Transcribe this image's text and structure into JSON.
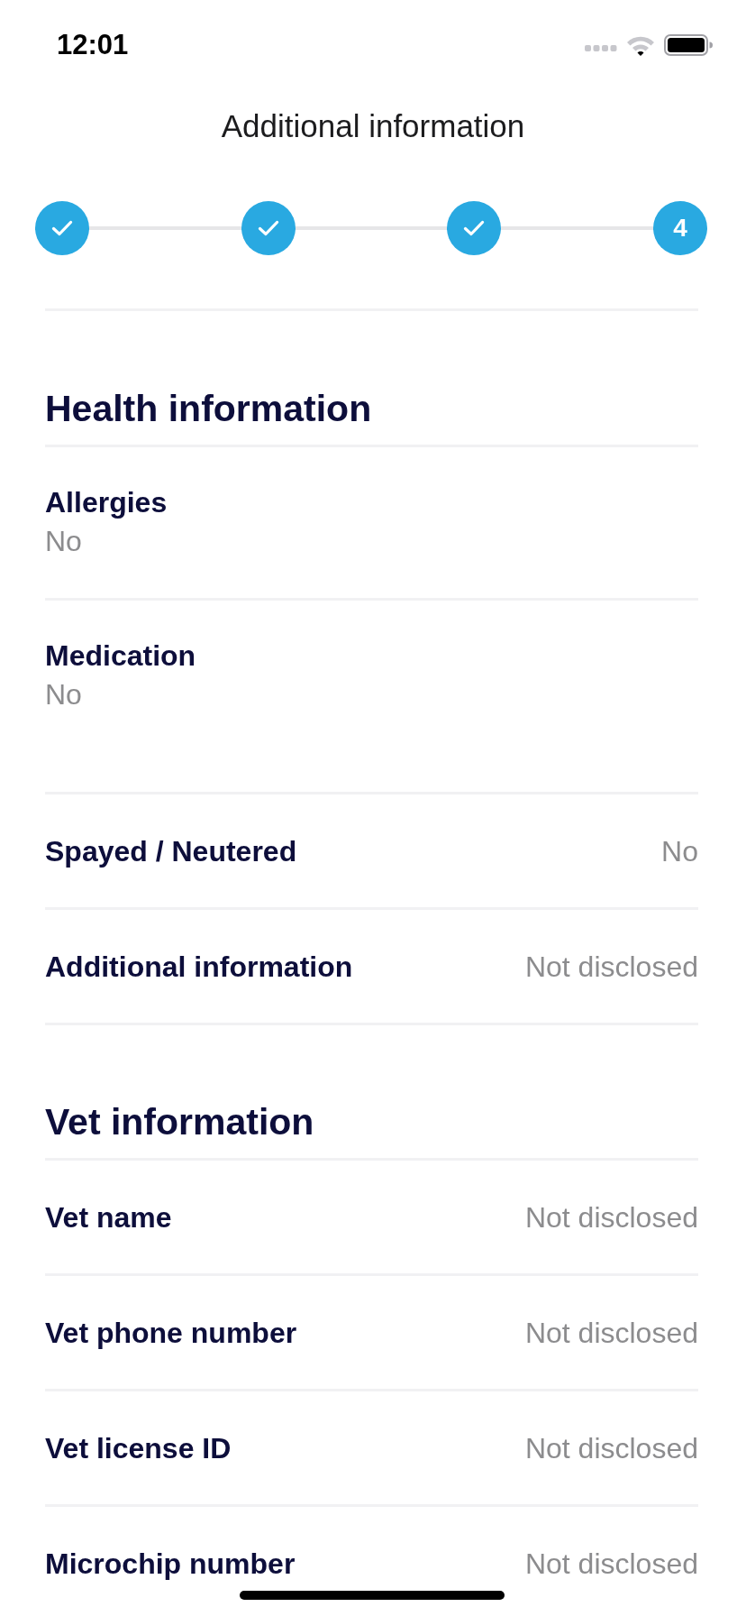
{
  "status_bar": {
    "time": "12:01"
  },
  "header": {
    "title": "Additional information"
  },
  "stepper": [
    {
      "completed": true
    },
    {
      "completed": true
    },
    {
      "completed": true
    },
    {
      "completed": false,
      "number": "4"
    }
  ],
  "sections": [
    {
      "title": "Health information",
      "rows": [
        {
          "kind": "stacked",
          "label": "Allergies",
          "value": "No"
        },
        {
          "kind": "stacked",
          "label": "Medication",
          "value": "No"
        },
        {
          "kind": "inline",
          "label": "Spayed / Neutered",
          "value": "No"
        },
        {
          "kind": "inline",
          "label": "Additional information",
          "value": "Not disclosed"
        }
      ]
    },
    {
      "title": "Vet information",
      "rows": [
        {
          "kind": "inline",
          "label": "Vet name",
          "value": "Not disclosed"
        },
        {
          "kind": "inline",
          "label": "Vet phone number",
          "value": "Not disclosed"
        },
        {
          "kind": "inline",
          "label": "Vet license ID",
          "value": "Not disclosed"
        },
        {
          "kind": "inline",
          "label": "Microchip number",
          "value": "Not disclosed"
        }
      ]
    }
  ]
}
